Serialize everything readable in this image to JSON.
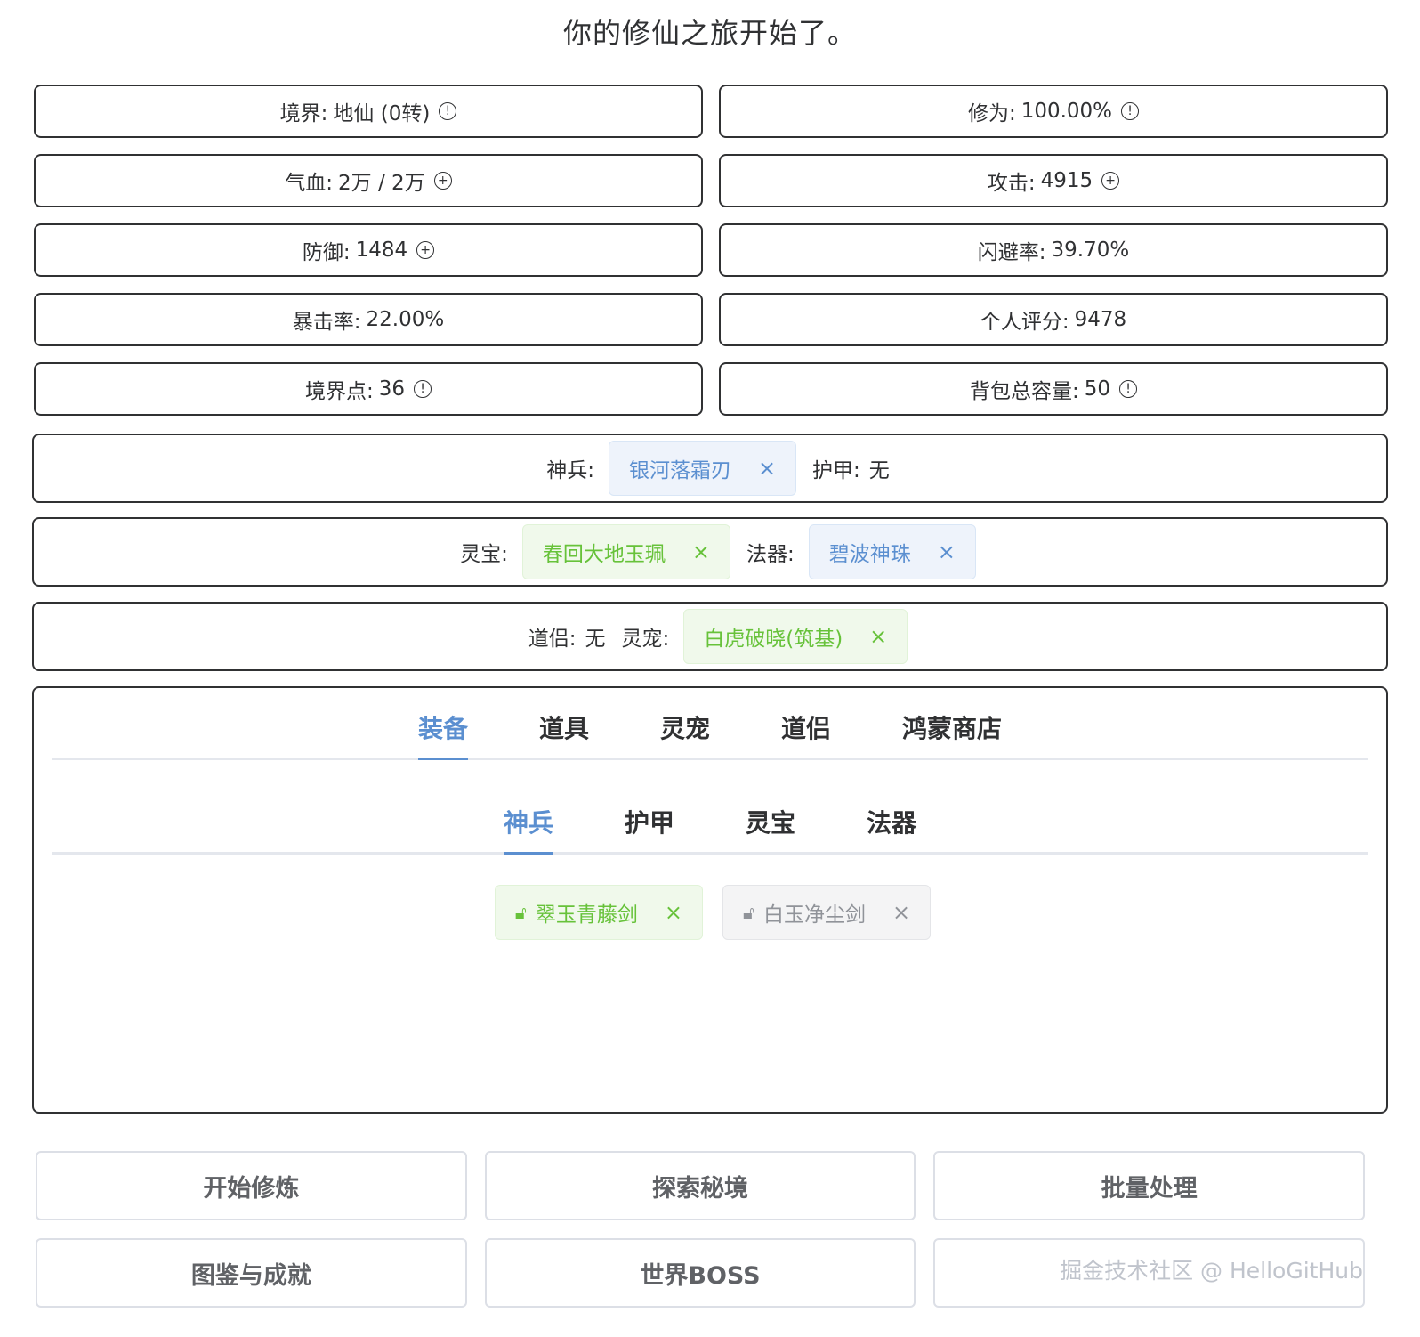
{
  "title": "你的修仙之旅开始了。",
  "stats": [
    {
      "label": "境界:",
      "value": "地仙 (0转)",
      "icon": "info-icon"
    },
    {
      "label": "修为:",
      "value": "100.00%",
      "icon": "info-icon"
    },
    {
      "label": "气血:",
      "value": "2万 / 2万",
      "icon": "plus-icon"
    },
    {
      "label": "攻击:",
      "value": "4915",
      "icon": "plus-icon"
    },
    {
      "label": "防御:",
      "value": "1484",
      "icon": "plus-icon"
    },
    {
      "label": "闪避率:",
      "value": "39.70%",
      "icon": ""
    },
    {
      "label": "暴击率:",
      "value": "22.00%",
      "icon": ""
    },
    {
      "label": "个人评分:",
      "value": "9478",
      "icon": ""
    },
    {
      "label": "境界点:",
      "value": "36",
      "icon": "info-icon"
    },
    {
      "label": "背包总容量:",
      "value": "50",
      "icon": "info-icon"
    }
  ],
  "equipped": {
    "weapon_label": "神兵:",
    "weapon": "银河落霜刃",
    "armor_label": "护甲:",
    "armor": "无",
    "treasure_label": "灵宝:",
    "treasure": "春回大地玉珮",
    "artifact_label": "法器:",
    "artifact": "碧波神珠",
    "companion_label": "道侣:",
    "companion": "无",
    "pet_label": "灵宠:",
    "pet": "白虎破晓(筑基)"
  },
  "tabs": [
    "装备",
    "道具",
    "灵宠",
    "道侣",
    "鸿蒙商店"
  ],
  "subtabs": [
    "神兵",
    "护甲",
    "灵宝",
    "法器"
  ],
  "items": [
    "翠玉青藤剑",
    "白玉净尘剑"
  ],
  "buttons": [
    "开始修炼",
    "探索秘境",
    "批量处理",
    "图鉴与成就",
    "世界BOSS",
    ""
  ],
  "watermark": "掘金技术社区 @ HelloGitHub",
  "colors": {
    "accent": "#5b8fd0",
    "green": "#67c23a",
    "gray": "#909399"
  }
}
